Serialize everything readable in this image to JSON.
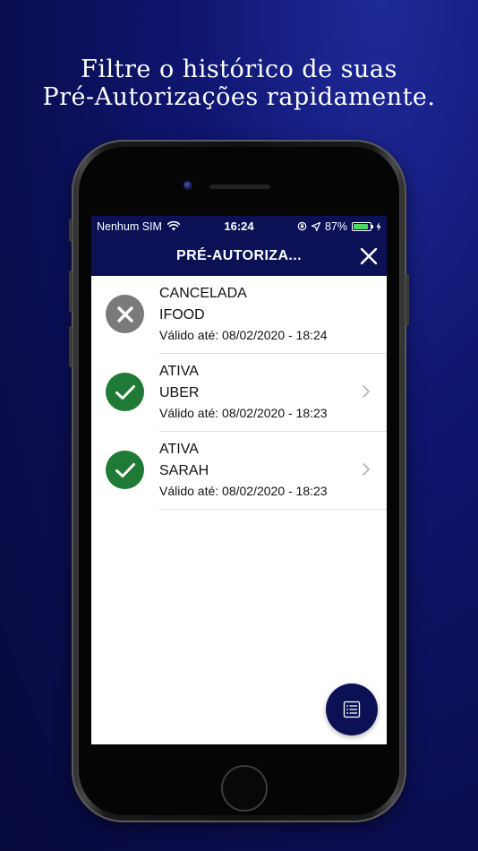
{
  "headline": {
    "line1": "Filtre o histórico de suas",
    "line2": "Pré-Autorizações rapidamente."
  },
  "status_bar": {
    "carrier": "Nenhum SIM",
    "time": "16:24",
    "battery": "87%",
    "battery_level": 0.87,
    "battery_color": "#4cd964"
  },
  "navbar": {
    "title": "PRÉ-AUTORIZA...",
    "close_icon": "close-icon",
    "background": "#0c1156"
  },
  "items": [
    {
      "status": "CANCELADA",
      "merchant": "IFOOD",
      "validity": "Válido até: 08/02/2020 - 18:24",
      "icon": "cancel-circle-icon",
      "icon_color": "#7a7a7a",
      "has_chevron": false
    },
    {
      "status": "ATIVA",
      "merchant": "UBER",
      "validity": "Válido até: 08/02/2020 - 18:23",
      "icon": "check-circle-icon",
      "icon_color": "#1e7a34",
      "has_chevron": true
    },
    {
      "status": "ATIVA",
      "merchant": "SARAH",
      "validity": "Válido até: 08/02/2020 - 18:23",
      "icon": "check-circle-icon",
      "icon_color": "#1e7a34",
      "has_chevron": true
    }
  ],
  "fab": {
    "icon": "list-filter-icon"
  }
}
